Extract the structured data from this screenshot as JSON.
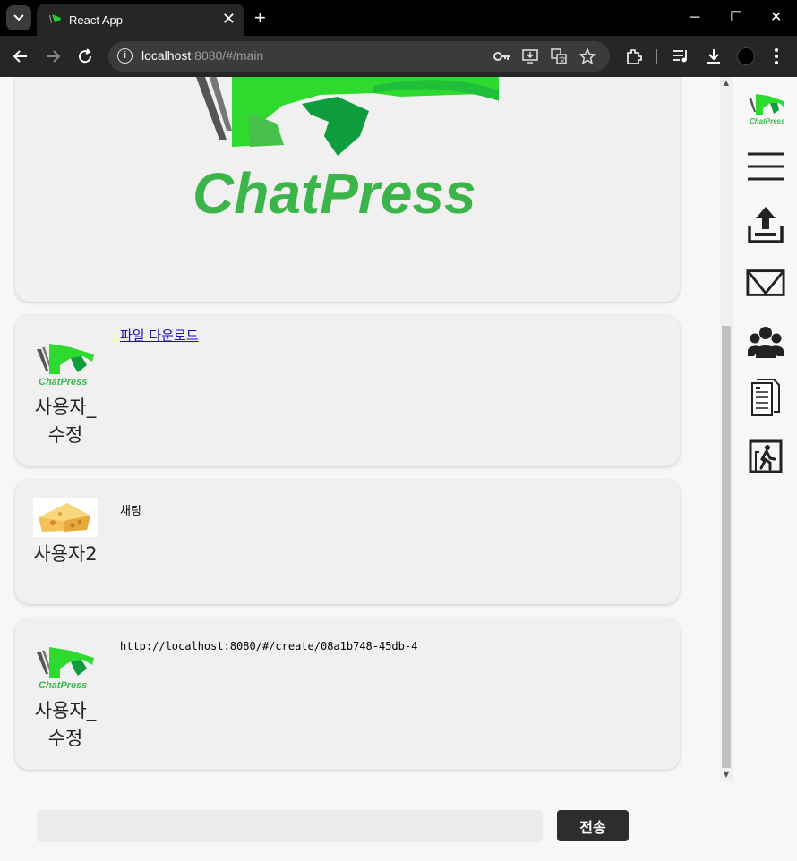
{
  "browser": {
    "tab_title": "React App",
    "tab_close": "✕",
    "new_tab": "+",
    "url_host": "localhost",
    "url_rest": ":8080/#/main",
    "window_minimize": "─",
    "window_maximize": "☐",
    "window_close": "✕"
  },
  "brand": {
    "name": "ChatPress",
    "green": "#3bb54a",
    "bright_green": "#22dd22",
    "dark_green": "#0f8a3a"
  },
  "messages": [
    {
      "username": "사용자_수정",
      "avatar": "chatpress-logo-avatar",
      "link_text": "파일 다운로드"
    },
    {
      "username": "사용자2",
      "avatar": "cheese-avatar",
      "text": "채팅"
    },
    {
      "username": "사용자_수정",
      "avatar": "chatpress-logo-avatar",
      "text": "http://localhost:8080/#/create/08a1b748-45db-4"
    }
  ],
  "sidebar": {
    "items": [
      {
        "icon": "chatpress-logo-icon"
      },
      {
        "icon": "menu-icon"
      },
      {
        "icon": "upload-icon"
      },
      {
        "icon": "mail-icon"
      },
      {
        "icon": "users-icon"
      },
      {
        "icon": "document-icon"
      },
      {
        "icon": "exit-icon"
      }
    ]
  },
  "composer": {
    "input_value": "",
    "send_label": "전송"
  }
}
